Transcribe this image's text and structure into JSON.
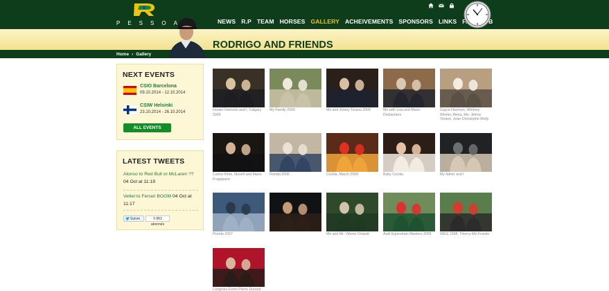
{
  "header": {
    "brand": "PESSOA",
    "nav": [
      "NEWS",
      "R.P",
      "TEAM",
      "HORSES",
      "GALLERY",
      "ACHEIVEMENTS",
      "SPONSORS",
      "LINKS",
      "FAN CLUB"
    ],
    "active_nav": "GALLERY",
    "top_icons": [
      "home-icon",
      "mail-icon",
      "login-icon"
    ]
  },
  "page": {
    "title": "RODRIGO AND FRIENDS"
  },
  "breadcrumb": {
    "home": "Home",
    "separator": "›",
    "current": "Gallery"
  },
  "events": {
    "title": "NEXT EVENTS",
    "items": [
      {
        "name": "CSIO Barcelona",
        "dates": "09.10.2014 - 12.10.2014",
        "flag": "spain-flag"
      },
      {
        "name": "CSIW Helsinki",
        "dates": "23.10.2014 - 26.10.2014",
        "flag": "finland-flag"
      }
    ],
    "button": "ALL EVENTS"
  },
  "tweets": {
    "title": "LATEST TWEETS",
    "items": [
      {
        "text": "Alonso to Red Bull or McLaren ??",
        "time": "04 Oct at 11:19"
      },
      {
        "text": "Vettel to Ferrari BOOM",
        "time": "04 Oct at 11:17"
      }
    ],
    "follow_label": "Suivre",
    "follower_count": "9 883 abonnés"
  },
  "gallery": [
    {
      "caption": "Hunter Harrison and I, Calgary 2009"
    },
    {
      "caption": "My Family 2009"
    },
    {
      "caption": "Me and Jimmy Torano 2009"
    },
    {
      "caption": "Me with Lisa and Mario Deslauriers"
    },
    {
      "caption": "Cayce Harrison, Whitney Weeks, Alexa, Me, Jimmy Torano, Jean-Christophe Molly"
    },
    {
      "caption": "Carlos Pinto, Myself and Mario Fragapane"
    },
    {
      "caption": "Florida 2006"
    },
    {
      "caption": "Cecilia, March 2009"
    },
    {
      "caption": "Baby Cecilia"
    },
    {
      "caption": "My father and I"
    },
    {
      "caption": "Florida 2007"
    },
    {
      "caption": ""
    },
    {
      "caption": "Me and Mr. Vittorio Orlandi"
    },
    {
      "caption": "Audi Equestrian Masters 2005"
    },
    {
      "caption": "WEG 1998, Thierry-Me-Franke"
    },
    {
      "caption": "Longines Event Pierre Durand"
    }
  ],
  "colors": {
    "header_green": "#0d3d1b",
    "accent_yellow": "#f1c40f",
    "link_green": "#1f7a3a",
    "button_green": "#148c2a"
  }
}
